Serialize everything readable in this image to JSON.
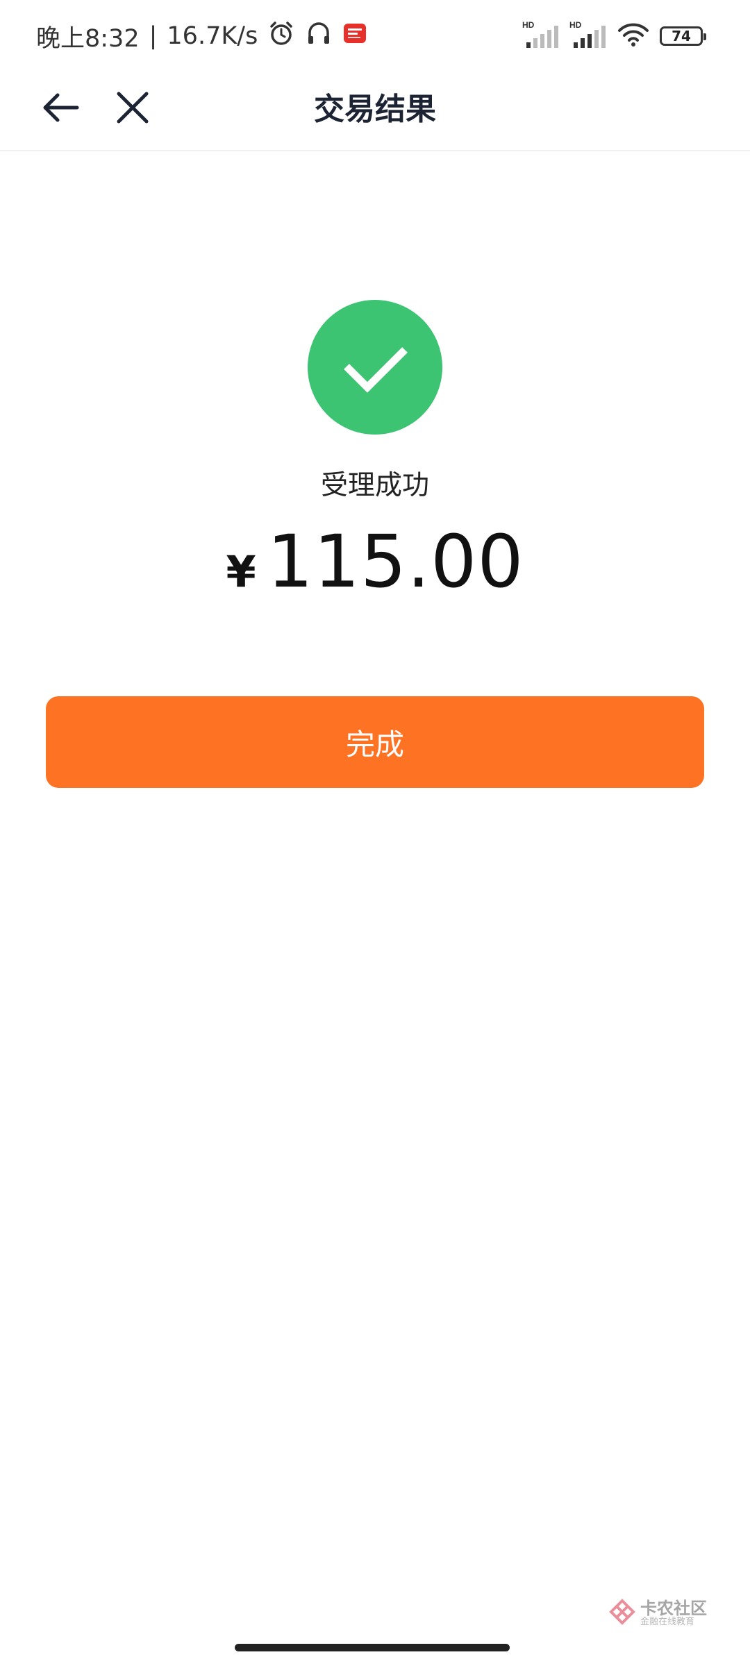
{
  "status_bar": {
    "time": "晚上8:32",
    "separator": "|",
    "network_speed": "16.7K/s",
    "battery_level": "74",
    "signal1_label": "HD",
    "signal2_label": "HD",
    "icons": [
      "alarm-icon",
      "headset-icon",
      "app-notification-icon",
      "signal-icon",
      "wifi-icon",
      "battery-icon"
    ]
  },
  "nav": {
    "title": "交易结果",
    "back_icon": "arrow-left-icon",
    "close_icon": "close-icon"
  },
  "result": {
    "icon": "check-circle-icon",
    "status_text": "受理成功",
    "currency_symbol": "¥",
    "amount": "115.00"
  },
  "done_button": {
    "label": "完成"
  },
  "watermark": {
    "title": "卡农社区",
    "subtitle": "金融在线教育"
  },
  "colors": {
    "success_green": "#3dc473",
    "button_orange": "#fd7223",
    "title_dark": "#1c2333"
  }
}
